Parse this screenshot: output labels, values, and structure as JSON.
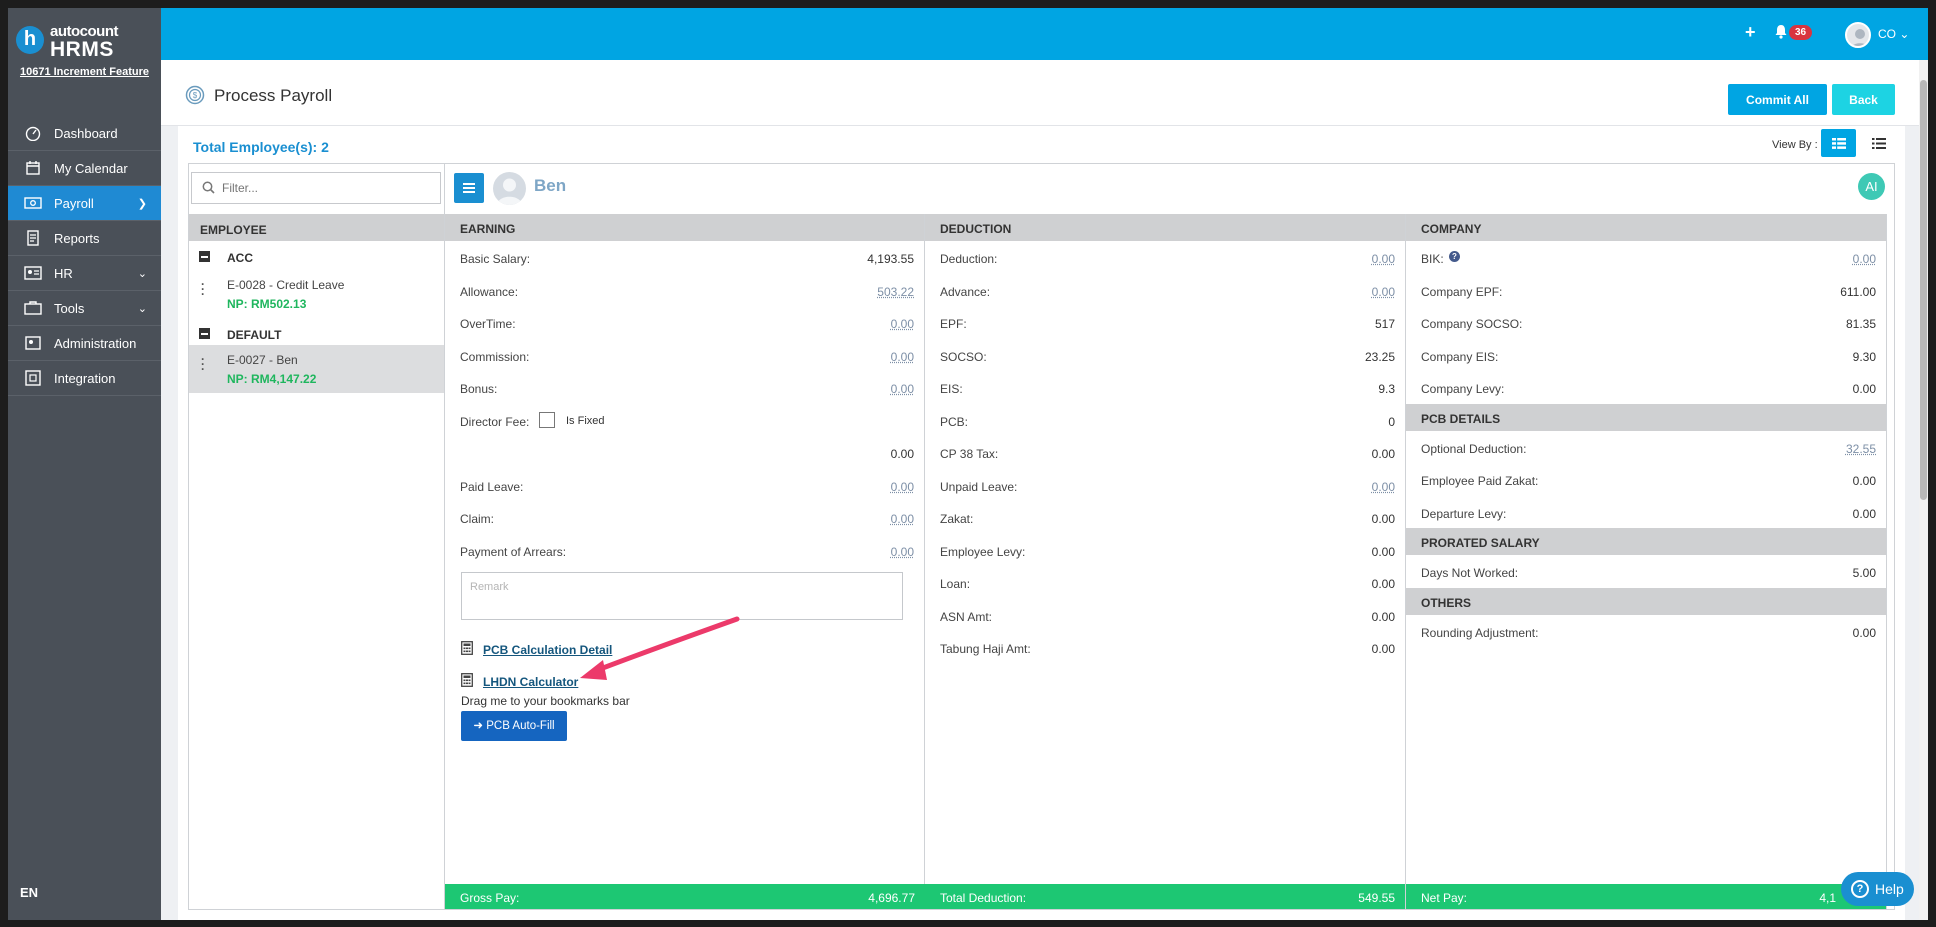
{
  "brand": {
    "top": "autocount",
    "bottom": "HRMS",
    "logo_letter": "h"
  },
  "feature_label": "10671 Increment Feature",
  "nav": [
    {
      "label": "Dashboard",
      "icon": "dashboard-icon"
    },
    {
      "label": "My Calendar",
      "icon": "calendar-icon"
    },
    {
      "label": "Payroll",
      "icon": "payroll-icon",
      "active": true
    },
    {
      "label": "Reports",
      "icon": "reports-icon"
    },
    {
      "label": "HR",
      "icon": "hr-icon"
    },
    {
      "label": "Tools",
      "icon": "tools-icon"
    },
    {
      "label": "Administration",
      "icon": "admin-icon"
    },
    {
      "label": "Integration",
      "icon": "integration-icon"
    }
  ],
  "language": "EN",
  "topbar": {
    "notification_count": "36",
    "user": "CO"
  },
  "page": {
    "title": "Process Payroll",
    "commit_all": "Commit All",
    "back": "Back"
  },
  "total_employees": "Total Employee(s): 2",
  "view_by": "View By :",
  "filter_placeholder": "Filter...",
  "employee_header": "EMPLOYEE",
  "groups": [
    {
      "name": "ACC",
      "employees": [
        {
          "name": "E-0028 - Credit Leave",
          "np": "NP: RM502.13"
        }
      ]
    },
    {
      "name": "DEFAULT",
      "employees": [
        {
          "name": "E-0027 - Ben",
          "np": "NP: RM4,147.22"
        }
      ]
    }
  ],
  "selected_employee": "Ben",
  "ai_label": "AI",
  "earning": {
    "header": "EARNING",
    "rows": [
      {
        "label": "Basic Salary:",
        "value": "4,193.55",
        "link": false
      },
      {
        "label": "Allowance:",
        "value": "503.22",
        "link": true
      },
      {
        "label": "OverTime:",
        "value": "0.00",
        "link": true
      },
      {
        "label": "Commission:",
        "value": "0.00",
        "link": true
      },
      {
        "label": "Bonus:",
        "value": "0.00",
        "link": true
      }
    ],
    "director_fee_label": "Director Fee:",
    "is_fixed_label": "Is Fixed",
    "director_fee_value": "0.00",
    "rows2": [
      {
        "label": "Paid Leave:",
        "value": "0.00",
        "link": true
      },
      {
        "label": "Claim:",
        "value": "0.00",
        "link": true
      },
      {
        "label": "Payment of Arrears:",
        "value": "0.00",
        "link": true
      }
    ],
    "remark_placeholder": "Remark",
    "pcb_link": "PCB Calculation Detail",
    "lhdn_link": "LHDN Calculator",
    "drag_text": "Drag me to your bookmarks bar",
    "autofill_button": "➜ PCB Auto-Fill",
    "gross_label": "Gross Pay:",
    "gross_value": "4,696.77"
  },
  "deduction": {
    "header": "DEDUCTION",
    "rows": [
      {
        "label": "Deduction:",
        "value": "0.00",
        "link": true
      },
      {
        "label": "Advance:",
        "value": "0.00",
        "link": true
      },
      {
        "label": "EPF:",
        "value": "517",
        "link": false
      },
      {
        "label": "SOCSO:",
        "value": "23.25",
        "link": false
      },
      {
        "label": "EIS:",
        "value": "9.3",
        "link": false
      },
      {
        "label": "PCB:",
        "value": "0",
        "link": false
      },
      {
        "label": "CP 38 Tax:",
        "value": "0.00",
        "link": false
      },
      {
        "label": "Unpaid Leave:",
        "value": "0.00",
        "link": true
      },
      {
        "label": "Zakat:",
        "value": "0.00",
        "link": false
      },
      {
        "label": "Employee Levy:",
        "value": "0.00",
        "link": false
      },
      {
        "label": "Loan:",
        "value": "0.00",
        "link": false
      },
      {
        "label": "ASN Amt:",
        "value": "0.00",
        "link": false
      },
      {
        "label": "Tabung Haji Amt:",
        "value": "0.00",
        "link": false
      }
    ],
    "total_label": "Total Deduction:",
    "total_value": "549.55"
  },
  "company": {
    "header": "COMPANY",
    "rows": [
      {
        "label": "BIK:",
        "value": "0.00",
        "link": true,
        "help": true
      },
      {
        "label": "Company EPF:",
        "value": "611.00",
        "link": false
      },
      {
        "label": "Company SOCSO:",
        "value": "81.35",
        "link": false
      },
      {
        "label": "Company EIS:",
        "value": "9.30",
        "link": false
      },
      {
        "label": "Company Levy:",
        "value": "0.00",
        "link": false
      }
    ],
    "pcb_header": "PCB DETAILS",
    "pcb_rows": [
      {
        "label": "Optional Deduction:",
        "value": "32.55",
        "link": true
      },
      {
        "label": "Employee Paid Zakat:",
        "value": "0.00",
        "link": false
      },
      {
        "label": "Departure Levy:",
        "value": "0.00",
        "link": false
      }
    ],
    "prorated_header": "PRORATED SALARY",
    "prorated_rows": [
      {
        "label": "Days Not Worked:",
        "value": "5.00",
        "link": false
      }
    ],
    "others_header": "OTHERS",
    "others_rows": [
      {
        "label": "Rounding Adjustment:",
        "value": "0.00",
        "link": false
      }
    ],
    "net_label": "Net Pay:",
    "net_value": "4,1"
  },
  "help_label": "Help",
  "colors": {
    "topbar": "#00a5e3",
    "sidebar": "#4a5058",
    "active": "#1f8ad3",
    "green": "#1dc773",
    "arrow": "#ec3a6a"
  }
}
